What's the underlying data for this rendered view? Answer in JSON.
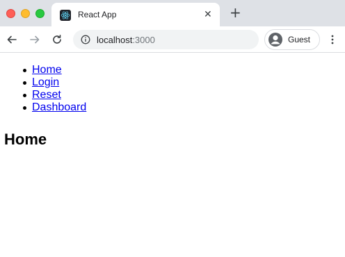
{
  "window": {
    "colors": {
      "close": "#fe5f57",
      "minimize": "#febc2e",
      "zoom": "#28c840"
    }
  },
  "tab": {
    "title": "React App",
    "close_icon": "close-icon",
    "favicon": "react-logo-icon"
  },
  "toolbar": {
    "back_icon": "arrow-left-icon",
    "forward_icon": "arrow-right-icon",
    "reload_icon": "reload-icon",
    "url_host": "localhost",
    "url_port": ":3000",
    "profile_label": "Guest",
    "menu_icon": "kebab-menu-icon"
  },
  "page": {
    "nav_links": [
      "Home",
      "Login",
      "Reset",
      "Dashboard"
    ],
    "heading": "Home",
    "link_color": "#0000ee"
  }
}
